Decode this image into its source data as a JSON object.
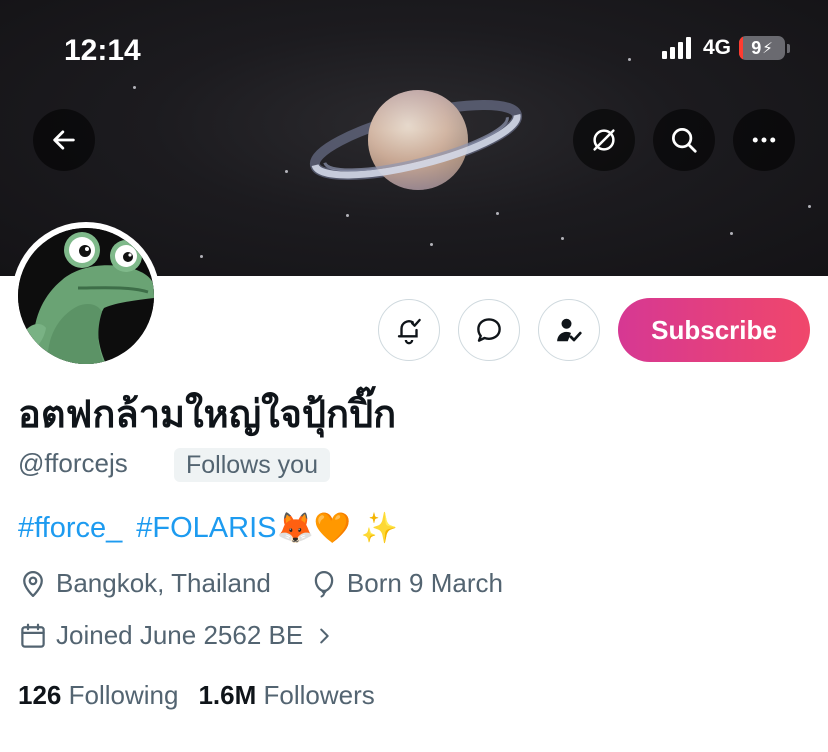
{
  "status_bar": {
    "time": "12:14",
    "network": "4G",
    "battery": "9"
  },
  "header": {
    "back_icon": "arrow-left-icon",
    "actions": [
      "link-off-icon",
      "search-icon",
      "more-icon"
    ]
  },
  "profile": {
    "display_name": "อตฟกล้ามใหญ่ใจปุ้กปิ๊ก",
    "handle": "@fforcejs",
    "follows_you": "Follows you",
    "bio": {
      "hashtag1": "#fforce_",
      "hashtag2": "#FOLARIS",
      "emojis": "🦊🧡 ✨"
    },
    "location": "Bangkok, Thailand",
    "birthday": "Born 9 March",
    "joined": "Joined June 2562 BE",
    "following_count": "126",
    "following_label": "Following",
    "followers_count": "1.6M",
    "followers_label": "Followers"
  },
  "actions": {
    "notify_icon": "bell-check-icon",
    "message_icon": "message-bubble-icon",
    "following_icon": "user-check-icon",
    "subscribe_label": "Subscribe"
  },
  "colors": {
    "link": "#1d9bf0",
    "secondary_text": "#536471",
    "subscribe_gradient_start": "#d63893",
    "subscribe_gradient_end": "#f0476b"
  }
}
